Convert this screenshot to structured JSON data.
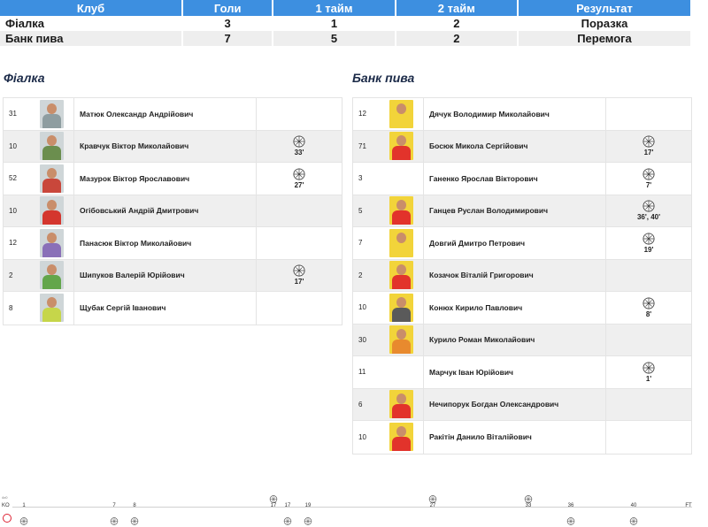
{
  "score_table": {
    "headers": [
      "Клуб",
      "Голи",
      "1 тайм",
      "2 тайм",
      "Результат"
    ],
    "rows": [
      {
        "club": "Фіалка",
        "goals": "3",
        "h1": "1",
        "h2": "2",
        "result": "Поразка"
      },
      {
        "club": "Банк пива",
        "goals": "7",
        "h1": "5",
        "h2": "2",
        "result": "Перемога"
      }
    ]
  },
  "teams": [
    {
      "title": "Фіалка",
      "players": [
        {
          "num": "31",
          "name": "Матюк Олександр Андрійович",
          "goals": "",
          "kit": "#8e9da0"
        },
        {
          "num": "10",
          "name": "Кравчук Віктор Миколайович",
          "goals": "33'",
          "kit": "#6b8e4e"
        },
        {
          "num": "52",
          "name": "Мазурок Віктор Ярославович",
          "goals": "27'",
          "kit": "#c9473b"
        },
        {
          "num": "10",
          "name": "Огібовський Андрій Дмитрович",
          "goals": "",
          "kit": "#d4362e"
        },
        {
          "num": "12",
          "name": "Панасюк Віктор Миколайович",
          "goals": "",
          "kit": "#8a70b8"
        },
        {
          "num": "2",
          "name": "Шипуков Валерій Юрійович",
          "goals": "17'",
          "kit": "#63a64b"
        },
        {
          "num": "8",
          "name": "Щубак Сергій Іванович",
          "goals": "",
          "kit": "#c6d64a"
        }
      ]
    },
    {
      "title": "Банк пива",
      "players": [
        {
          "num": "12",
          "name": "Дячук Володимир Миколайович",
          "goals": "",
          "kit": "#f2d43a",
          "photo": true
        },
        {
          "num": "71",
          "name": "Босюк Микола Сергійович",
          "goals": "17'",
          "kit": "#e2332b",
          "photo": true
        },
        {
          "num": "3",
          "name": "Ганенко Ярослав Вікторович",
          "goals": "7'",
          "kit": "",
          "photo": false
        },
        {
          "num": "5",
          "name": "Ганцев Руслан Володимирович",
          "goals": "36', 40'",
          "kit": "#e2332b",
          "photo": true
        },
        {
          "num": "7",
          "name": "Довгий Дмитро Петрович",
          "goals": "19'",
          "kit": "#f2d43a",
          "photo": true
        },
        {
          "num": "2",
          "name": "Козачок Віталій Григорович",
          "goals": "",
          "kit": "#e2332b",
          "photo": true
        },
        {
          "num": "10",
          "name": "Конюх Кирило Павлович",
          "goals": "8'",
          "kit": "#5a5a5a",
          "photo": true
        },
        {
          "num": "30",
          "name": "Курило Роман Миколайович",
          "goals": "",
          "kit": "#e88a2e",
          "photo": true
        },
        {
          "num": "11",
          "name": "Марчук Іван Юрійович",
          "goals": "1'",
          "kit": "",
          "photo": false
        },
        {
          "num": "6",
          "name": "Нечипорук Богдан Олександрович",
          "goals": "",
          "kit": "#e2332b",
          "photo": true
        },
        {
          "num": "10",
          "name": "Ракітін Данило Віталійович",
          "goals": "",
          "kit": "#e2332b",
          "photo": true
        }
      ]
    }
  ],
  "timeline": {
    "start_label": "KO",
    "end_label": "FT",
    "small_label": "4x0",
    "ticks": [
      {
        "label": "1",
        "minute": 1
      },
      {
        "label": "7",
        "minute": 7
      },
      {
        "label": "8",
        "minute": 8
      },
      {
        "label": "17",
        "minute": 17
      },
      {
        "label": "17",
        "minute": 17.6
      },
      {
        "label": "19",
        "minute": 19
      },
      {
        "label": "27",
        "minute": 27
      },
      {
        "label": "33",
        "minute": 33
      },
      {
        "label": "36",
        "minute": 36
      },
      {
        "label": "40",
        "minute": 40
      }
    ],
    "events_top": [
      17,
      27,
      33
    ],
    "events_bottom": [
      1,
      7,
      8,
      17.6,
      19,
      36,
      40
    ],
    "total_minutes": 50
  },
  "colors": {
    "header_blue": "#3d8fe0",
    "title_navy": "#1b2a48"
  }
}
